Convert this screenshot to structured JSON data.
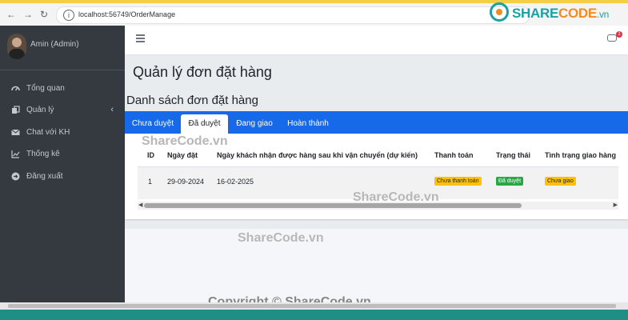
{
  "browser": {
    "url": "localhost:56749/OrderManage",
    "back_icon": "←",
    "forward_icon": "→",
    "reload_icon": "↻"
  },
  "brand": {
    "part1": "SHARE",
    "part2": "CODE",
    "suffix": ".vn"
  },
  "sidebar": {
    "user_name": "Amin (Admin)",
    "items": [
      {
        "label": "Tổng quan",
        "icon": "dashboard-icon"
      },
      {
        "label": "Quản lý",
        "icon": "copy-icon"
      },
      {
        "label": "Chat với KH",
        "icon": "envelope-icon"
      },
      {
        "label": "Thống kê",
        "icon": "chart-icon"
      },
      {
        "label": "Đăng xuất",
        "icon": "logout-icon"
      }
    ]
  },
  "header": {
    "notification_count": "1"
  },
  "page": {
    "title": "Quản lý đơn đặt hàng",
    "section_title": "Danh sách đơn đặt hàng"
  },
  "tabs": [
    {
      "label": "Chưa duyệt",
      "active": false
    },
    {
      "label": "Đã duyệt",
      "active": true
    },
    {
      "label": "Đang giao",
      "active": false
    },
    {
      "label": "Hoàn thành",
      "active": false
    }
  ],
  "table": {
    "columns": [
      "ID",
      "Ngày đặt",
      "Ngày khách nhận được hàng sau khi vận chuyển (dự kiến)",
      "Thanh toán",
      "Trạng thái",
      "Tình trạng giao hàng"
    ],
    "rows": [
      {
        "id": "1",
        "order_date": "29-09-2024",
        "expected_date": "16-02-2025",
        "payment": "Chưa thanh toán",
        "status": "Đã duyệt",
        "delivery": "Chưa giao"
      }
    ]
  },
  "colors": {
    "sidebar_bg": "#343a40",
    "tab_bar": "#1669e9",
    "badge_warning": "#ffc107",
    "badge_success": "#28a745",
    "accent_teal": "#1aa1a4",
    "accent_orange": "#f28b22"
  },
  "watermarks": {
    "w1": "ShareCode.vn",
    "w2": "ShareCode.vn",
    "w3": "ShareCode.vn",
    "copyright": "Copyright © ShareCode.vn"
  }
}
